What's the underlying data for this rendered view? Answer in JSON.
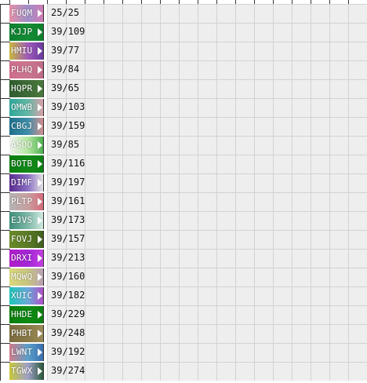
{
  "rows": [
    {
      "label": "FUQM",
      "count": "25/25",
      "colors": [
        "#e58fa6",
        "#9e8fc8",
        "#d27bb5"
      ]
    },
    {
      "label": "KJJP",
      "count": "39/109",
      "colors": [
        "#0e7f2e",
        "#168c36",
        "#0f7f2c"
      ]
    },
    {
      "label": "HMIU",
      "count": "39/77",
      "colors": [
        "#c8b83c",
        "#9e5ab8",
        "#6a3a9e"
      ]
    },
    {
      "label": "PLHQ",
      "count": "39/84",
      "colors": [
        "#cf6d8c",
        "#c9778f",
        "#bf6a86"
      ]
    },
    {
      "label": "HQPR",
      "count": "39/65",
      "colors": [
        "#2f5d2f",
        "#3e6b36",
        "#4a7a3c"
      ]
    },
    {
      "label": "OMWB",
      "count": "39/103",
      "colors": [
        "#2fa89a",
        "#62b8a5",
        "#d9a0a8"
      ]
    },
    {
      "label": "CBGJ",
      "count": "39/159",
      "colors": [
        "#1e6f8a",
        "#3d8eaa",
        "#d48f8f"
      ]
    },
    {
      "label": "ASOO",
      "count": "39/85",
      "colors": [
        "#f2f2f2",
        "#b3e6a0",
        "#4caf50"
      ]
    },
    {
      "label": "BOTB",
      "count": "39/116",
      "colors": [
        "#0b7d10",
        "#118a18",
        "#0d8014"
      ]
    },
    {
      "label": "DIMF",
      "count": "39/197",
      "colors": [
        "#5a2c8c",
        "#8a6fc4",
        "#e3e3e3"
      ]
    },
    {
      "label": "PLTP",
      "count": "39/161",
      "colors": [
        "#b3b3b3",
        "#c8a0a0",
        "#d46a7a"
      ]
    },
    {
      "label": "EJVS",
      "count": "39/173",
      "colors": [
        "#3e8e7a",
        "#7fb8a8",
        "#cfe8e0"
      ]
    },
    {
      "label": "FOVJ",
      "count": "39/157",
      "colors": [
        "#6b8a2a",
        "#5a7a26",
        "#3f5f1e"
      ]
    },
    {
      "label": "DRXI",
      "count": "39/213",
      "colors": [
        "#b01dc8",
        "#a226d6",
        "#c43ee0"
      ]
    },
    {
      "label": "MQWQ",
      "count": "39/160",
      "colors": [
        "#d8d87a",
        "#c7c47e",
        "#b8a0b4"
      ]
    },
    {
      "label": "XUIC",
      "count": "39/182",
      "colors": [
        "#1fc6b8",
        "#6aa8d8",
        "#b04fc8"
      ]
    },
    {
      "label": "HHDE",
      "count": "39/229",
      "colors": [
        "#0a7d0c",
        "#0f8a13",
        "#0c7f10"
      ]
    },
    {
      "label": "PHBT",
      "count": "39/248",
      "colors": [
        "#7a6a3e",
        "#8a7a48",
        "#9a8a56"
      ]
    },
    {
      "label": "LWNT",
      "count": "39/192",
      "colors": [
        "#d07a8a",
        "#5aa0c8",
        "#3a6fb0"
      ]
    },
    {
      "label": "TGWX",
      "count": "39/274",
      "colors": [
        "#c8c83a",
        "#9fa0c8",
        "#2a5a3a"
      ]
    }
  ]
}
